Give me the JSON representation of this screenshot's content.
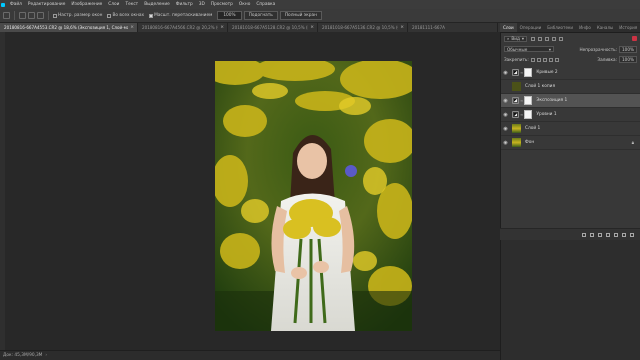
{
  "menu": {
    "items": [
      "Файл",
      "Редактирование",
      "Изображение",
      "Слои",
      "Текст",
      "Выделение",
      "Фильтр",
      "3D",
      "Просмотр",
      "Окно",
      "Справка"
    ]
  },
  "options": {
    "check1_label": "Настр. размер окон",
    "check2_label": "Во всех окнах",
    "check3_label": "Масшт. перетаскиванием",
    "zoom_value": "100%",
    "fit_button": "Подогнать",
    "fullscreen_button": "Полный экран"
  },
  "doc_tabs": [
    {
      "label": "20180816-667A4553.CR2 @ 18,6% (Экспозиция 1, Слой-маска/8) *",
      "active": true
    },
    {
      "label": "20180816-667A4566.CR2 @ 20,2% (Слой 1, RGB/8) *",
      "active": false
    },
    {
      "label": "20181018-667A5128.CR2 @ 10,5% (Цветовой тон/Насыщенность 1, Слой-маска/8) *",
      "active": false
    },
    {
      "label": "20181018-667A5136.CR2 @ 10,5% (Слой 1 копия, RGB/8) *",
      "active": false
    },
    {
      "label": "20181111-667A",
      "active": false
    }
  ],
  "status": {
    "doc_info": "Док: 45,3M/90,3M"
  },
  "panel_tabs": [
    "Слои",
    "Операции",
    "Библиотеки",
    "Инфо",
    "Каналы",
    "История"
  ],
  "layers_panel": {
    "filter_label": "Вид",
    "blend_mode": "Обычные",
    "opacity_label": "Непрозрачность:",
    "opacity_value": "100%",
    "lock_label": "Закрепить:",
    "fill_label": "Заливка:",
    "fill_value": "100%",
    "layers": [
      {
        "name": "Кривые 2",
        "kind": "adjustment",
        "visible": true,
        "selected": false
      },
      {
        "name": "Слой 1 копия",
        "kind": "fill",
        "visible": false,
        "selected": false
      },
      {
        "name": "Экспозиция 1",
        "kind": "adjustment",
        "visible": true,
        "selected": true
      },
      {
        "name": "Уровни 1",
        "kind": "adjustment",
        "visible": true,
        "selected": false
      },
      {
        "name": "Слой 1",
        "kind": "pixel",
        "visible": true,
        "selected": false
      },
      {
        "name": "Фон",
        "kind": "background",
        "visible": true,
        "selected": false,
        "locked": true
      }
    ]
  },
  "colors": {
    "app_bg": "#282828",
    "selected_layer": "#535353",
    "panel_bg": "#383838"
  }
}
